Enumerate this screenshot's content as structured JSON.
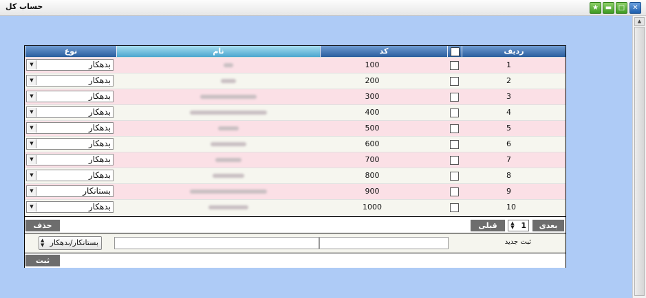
{
  "window": {
    "title": "حساب کل"
  },
  "grid": {
    "columns": {
      "row": "ردیف",
      "code": "کد",
      "name": "نام",
      "type": "نوع"
    },
    "rows": [
      {
        "num": "1",
        "code": "100",
        "type": "بدهکار"
      },
      {
        "num": "2",
        "code": "200",
        "type": "بدهکار"
      },
      {
        "num": "3",
        "code": "300",
        "type": "بدهکار"
      },
      {
        "num": "4",
        "code": "400",
        "type": "بدهکار"
      },
      {
        "num": "5",
        "code": "500",
        "type": "بدهکار"
      },
      {
        "num": "6",
        "code": "600",
        "type": "بدهکار"
      },
      {
        "num": "7",
        "code": "700",
        "type": "بدهکار"
      },
      {
        "num": "8",
        "code": "800",
        "type": "بدهکار"
      },
      {
        "num": "9",
        "code": "900",
        "type": "بستانکار"
      },
      {
        "num": "10",
        "code": "1000",
        "type": "بدهکار"
      }
    ]
  },
  "pager": {
    "next_label": "بعدی",
    "prev_label": "قبلی",
    "page": "1",
    "delete_label": "حذف"
  },
  "new_entry": {
    "label": "ثبت جدید",
    "type_value": "بستانکار/بدهکار",
    "submit_label": "ثبت"
  }
}
